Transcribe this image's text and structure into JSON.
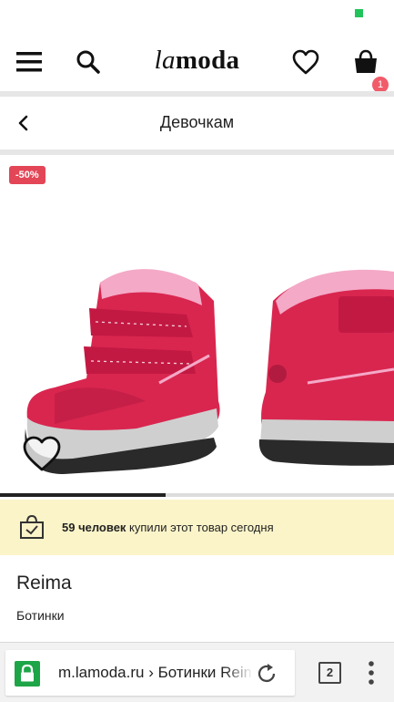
{
  "status_bar": {
    "indicator_color": "#21c35a"
  },
  "header": {
    "logo_la": "la",
    "logo_moda": "moda",
    "icons": [
      "menu-icon",
      "search-icon",
      "heart-icon",
      "cart-icon"
    ],
    "cart_count": "1",
    "cart_badge_color": "#f15b6a"
  },
  "subnav": {
    "title": "Девочкам"
  },
  "product": {
    "discount": "-50%",
    "discount_color": "#e34656",
    "gallery_progress": 0.42,
    "brand": "Reima",
    "category": "Ботинки"
  },
  "banner": {
    "count_text": "59 человек",
    "rest_text": " купили этот товар сегодня",
    "background": "#fbf4c9"
  },
  "browser": {
    "url": "m.lamoda.ru › Ботинки Reima",
    "tab_count": "2",
    "secure_color": "#1da547"
  }
}
